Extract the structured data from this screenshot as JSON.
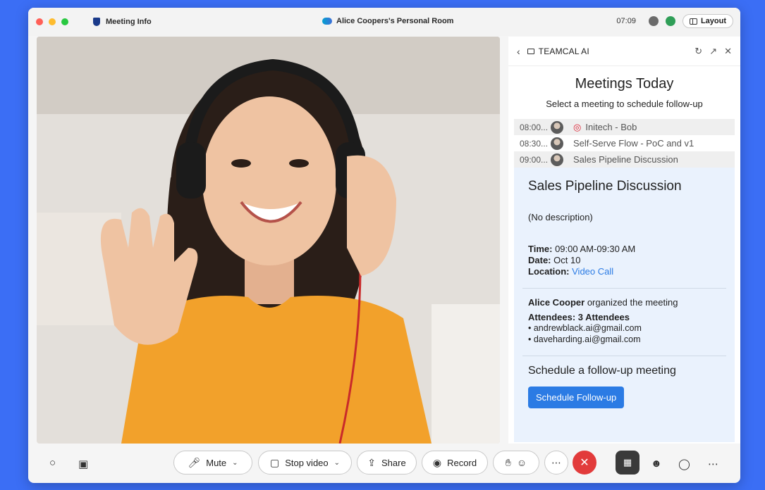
{
  "titlebar": {
    "meeting_info": "Meeting Info",
    "room_title": "Alice Coopers's Personal Room",
    "clock": "07:09",
    "layout_label": "Layout"
  },
  "panel": {
    "brand": "TEAMCAL AI",
    "title": "Meetings Today",
    "subtitle": "Select a meeting to schedule follow-up",
    "meetings": [
      {
        "time": "08:00...",
        "name": "Initech - Bob"
      },
      {
        "time": "08:30...",
        "name": "Self-Serve Flow - PoC and v1"
      },
      {
        "time": "09:00...",
        "name": "Sales Pipeline Discussion"
      }
    ],
    "detail": {
      "title": "Sales Pipeline Discussion",
      "description": "(No description)",
      "time_label": "Time:",
      "time_value": "09:00 AM-09:30 AM",
      "date_label": "Date:",
      "date_value": "Oct 10",
      "location_label": "Location:",
      "location_value": "Video Call",
      "organizer_name": "Alice Cooper",
      "organizer_text": "organized the meeting",
      "attendees_label": "Attendees: 3 Attendees",
      "attendees": [
        "andrewblack.ai@gmail.com",
        "daveharding.ai@gmail.com"
      ],
      "followup_heading": "Schedule a follow-up meeting",
      "followup_button": "Schedule Follow-up"
    }
  },
  "controls": {
    "mute": "Mute",
    "stop_video": "Stop video",
    "share": "Share",
    "record": "Record"
  },
  "colors": {
    "background": "#3b6ef5",
    "accent": "#2b7be4",
    "end_call": "#e23b3b",
    "detail_bg": "#eaf2fd"
  }
}
